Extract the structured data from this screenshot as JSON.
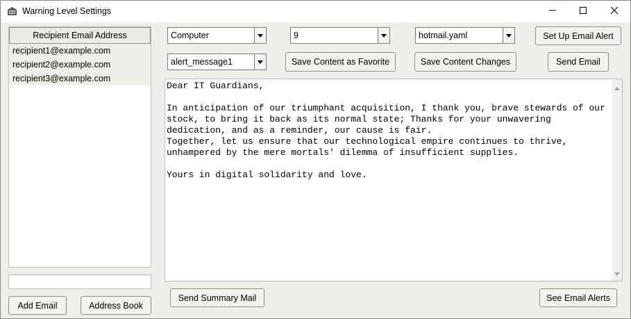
{
  "window": {
    "title": "Warning Level Settings"
  },
  "recipients": {
    "header": "Recipient Email Address",
    "items": [
      "recipient1@example.com",
      "recipient2@example.com",
      "recipient3@example.com"
    ],
    "new_email_value": "",
    "add_label": "Add Email",
    "book_label": "Address Book"
  },
  "toolbar": {
    "category_value": "Computer",
    "level_value": "9",
    "config_value": "hotmail.yaml",
    "setup_label": "Set Up Email Alert",
    "message_value": "alert_message1",
    "save_favorite_label": "Save Content as Favorite",
    "save_changes_label": "Save Content Changes",
    "send_label": "Send Email"
  },
  "message": {
    "body": "Dear IT Guardians,\n\nIn anticipation of our triumphant acquisition, I thank you, brave stewards of our stock, to bring it back as its normal state; Thanks for your unwavering dedication, and as a reminder, our cause is fair.\nTogether, let us ensure that our technological empire continues to thrive, unhampered by the mere mortals' dilemma of insufficient supplies.\n\nYours in digital solidarity and love."
  },
  "footer": {
    "summary_label": "Send Summary Mail",
    "alerts_label": "See Email Alerts"
  },
  "icons": {
    "app": "app-icon",
    "minimize": "minimize-icon",
    "maximize": "maximize-icon",
    "close": "close-icon",
    "dropdown": "chevron-down-icon",
    "scroll_up": "scroll-up-icon",
    "scroll_down": "scroll-down-icon"
  }
}
